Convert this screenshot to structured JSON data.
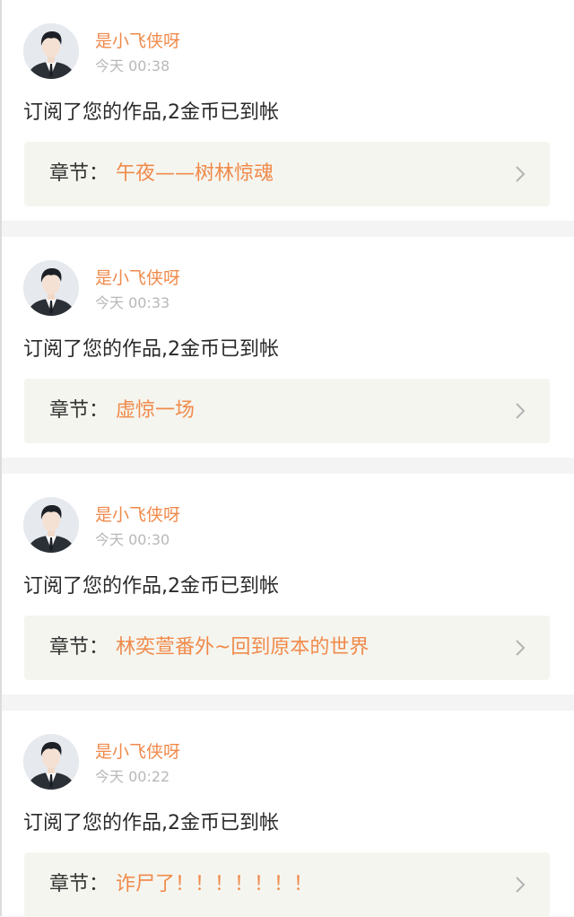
{
  "colors": {
    "accent": "#f08a4b",
    "background": "#f4f4f4",
    "card": "#ffffff",
    "chapter_box": "#f5f5ef"
  },
  "notifications": [
    {
      "username": "是小飞侠呀",
      "time": "今天 00:38",
      "message": "订阅了您的作品,2金币已到帐",
      "chapter_label": "章节：",
      "chapter_title": "午夜——树林惊魂"
    },
    {
      "username": "是小飞侠呀",
      "time": "今天 00:33",
      "message": "订阅了您的作品,2金币已到帐",
      "chapter_label": "章节：",
      "chapter_title": "虚惊一场"
    },
    {
      "username": "是小飞侠呀",
      "time": "今天 00:30",
      "message": "订阅了您的作品,2金币已到帐",
      "chapter_label": "章节：",
      "chapter_title": "林奕萱番外~回到原本的世界"
    },
    {
      "username": "是小飞侠呀",
      "time": "今天 00:22",
      "message": "订阅了您的作品,2金币已到帐",
      "chapter_label": "章节：",
      "chapter_title": "诈尸了！！！！！！！"
    }
  ]
}
